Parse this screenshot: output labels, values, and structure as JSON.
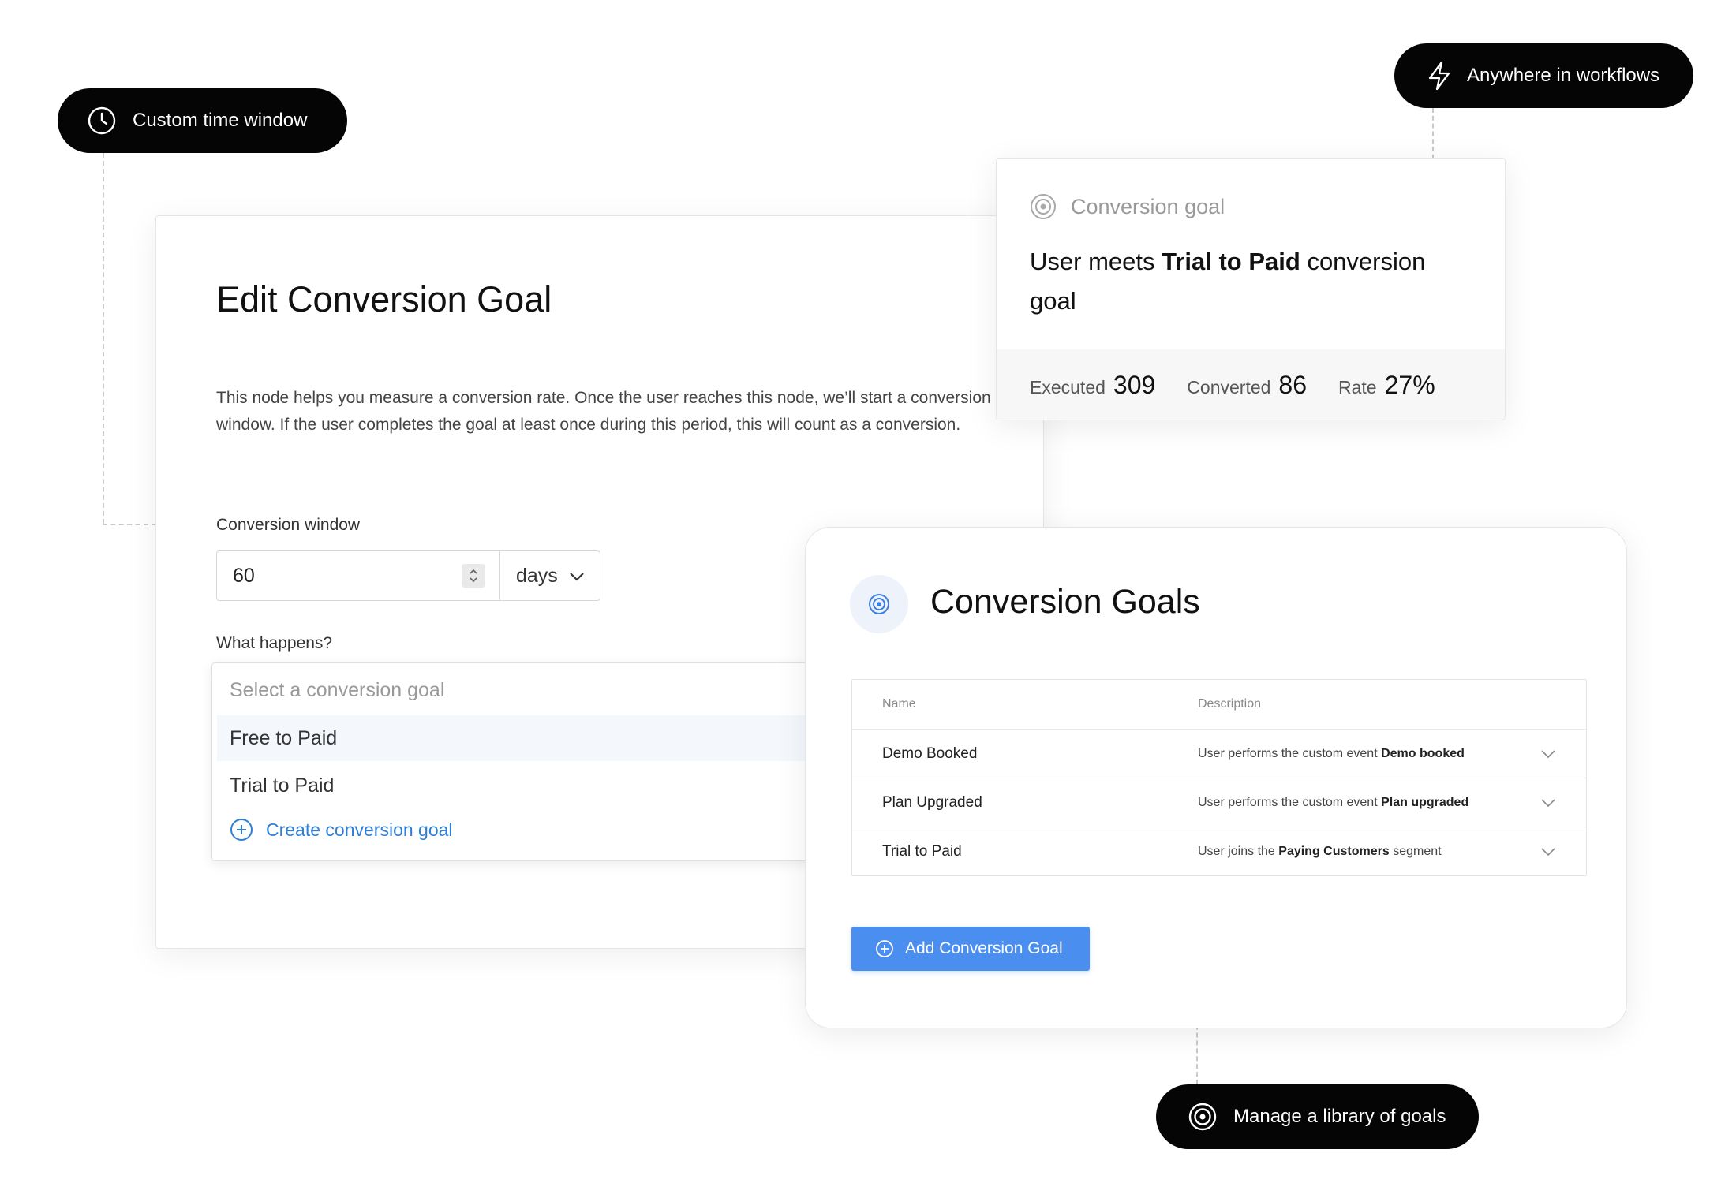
{
  "callouts": {
    "time_window": "Custom time window",
    "workflows": "Anywhere in workflows",
    "library": "Manage a library of goals"
  },
  "edit_card": {
    "title": "Edit Conversion Goal",
    "description": "This node helps you measure a conversion rate. Once the user reaches this node, we’ll start a conversion window. If the user completes the goal at least once during this period, this will count as a conversion.",
    "window_label": "Conversion window",
    "window_value": "60",
    "window_unit": "days",
    "what_happens_label": "What happens?",
    "select_placeholder": "Select a conversion goal",
    "options": [
      "Free to Paid",
      "Trial to Paid"
    ],
    "create_label": "Create conversion goal"
  },
  "goal_card": {
    "header": "Conversion goal",
    "title_prefix": "User meets ",
    "title_bold": "Trial to Paid",
    "title_suffix": " conversion goal",
    "stats": [
      {
        "label": "Executed",
        "value": "309"
      },
      {
        "label": "Converted",
        "value": "86"
      },
      {
        "label": "Rate",
        "value": "27%"
      }
    ]
  },
  "library": {
    "title": "Conversion Goals",
    "columns": {
      "name": "Name",
      "description": "Description"
    },
    "rows": [
      {
        "name": "Demo Booked",
        "desc_prefix": "User performs the custom event ",
        "desc_bold": "Demo booked",
        "desc_suffix": ""
      },
      {
        "name": "Plan Upgraded",
        "desc_prefix": "User performs the custom event ",
        "desc_bold": "Plan upgraded",
        "desc_suffix": ""
      },
      {
        "name": "Trial to Paid",
        "desc_prefix": "User joins the ",
        "desc_bold": "Paying Customers",
        "desc_suffix": " segment"
      }
    ],
    "add_button": "Add Conversion Goal"
  },
  "colors": {
    "pill_bg": "#050505",
    "accent_blue": "#4a8ff0",
    "link_blue": "#2f7fd6",
    "highlight_row": "#f4f7fc"
  }
}
